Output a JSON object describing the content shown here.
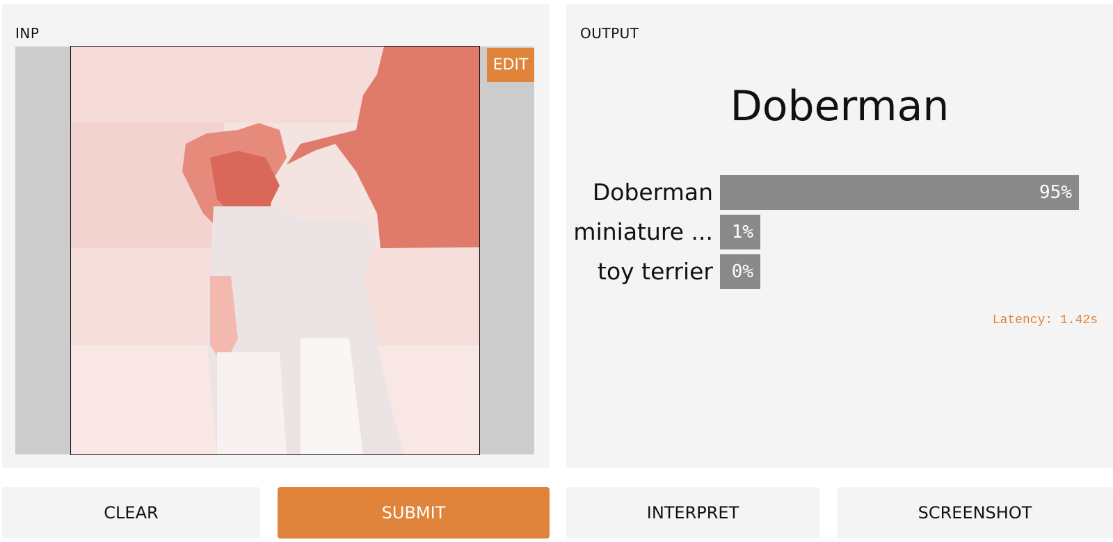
{
  "input": {
    "label": "INP",
    "edit_label": "EDIT"
  },
  "output": {
    "label": "OUTPUT",
    "top_prediction": "Doberman",
    "confidences": [
      {
        "label": "Doberman",
        "percent_text": "95%",
        "value": 0.95
      },
      {
        "label": "miniature ...",
        "percent_text": "1%",
        "value": 0.01
      },
      {
        "label": "toy terrier",
        "percent_text": "0%",
        "value": 0.0
      }
    ],
    "latency": "Latency: 1.42s"
  },
  "buttons": {
    "clear": "CLEAR",
    "submit": "SUBMIT",
    "interpret": "INTERPRET",
    "screenshot": "SCREENSHOT"
  },
  "colors": {
    "accent": "#df843a",
    "bar": "#8a8a8a",
    "panel": "#f4f4f4",
    "highlight": "#e07a6a"
  }
}
